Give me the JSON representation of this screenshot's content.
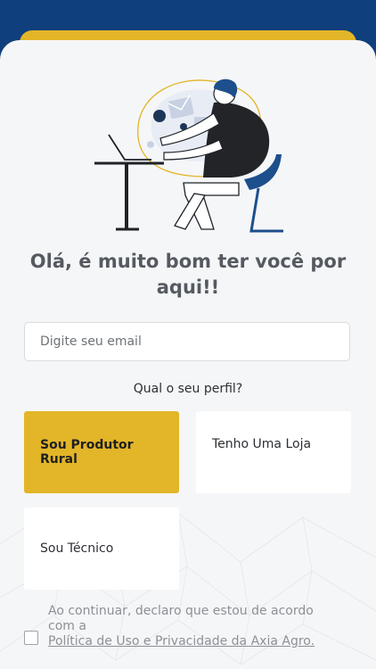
{
  "colors": {
    "header_blue": "#0f3f7c",
    "accent_gold": "#e3b528",
    "card_bg": "#f5f6f8"
  },
  "page": {
    "title": "Olá, é muito bom ter você por aqui!!"
  },
  "email": {
    "placeholder": "Digite seu email",
    "value": ""
  },
  "profile": {
    "question": "Qual o seu perfil?",
    "options": [
      {
        "label": "Sou Produtor Rural",
        "selected": true
      },
      {
        "label": "Tenho Uma Loja",
        "selected": false
      },
      {
        "label": "Sou Técnico",
        "selected": false
      }
    ]
  },
  "consent": {
    "text": "Ao continuar, declaro que estou de acordo com a",
    "link": "Política de Uso e Privacidade da Axia Agro.",
    "checked": false
  },
  "illustration": {
    "description_icon": "person-at-laptop-illustration"
  }
}
